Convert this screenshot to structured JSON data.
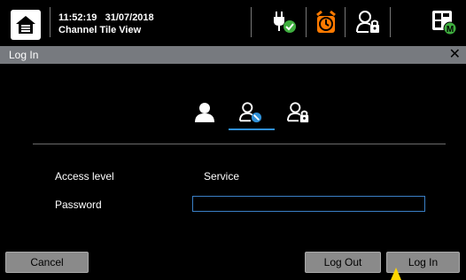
{
  "header": {
    "time": "11:52:19",
    "date": "31/07/2018",
    "view_name": "Channel Tile View",
    "icons": [
      "home-icon",
      "power-plug-check-icon",
      "alarm-clock-icon",
      "user-lock-icon",
      "tile-grid-m-icon"
    ],
    "accent_orange": "#ff7a00",
    "accent_green": "#3fae3f"
  },
  "dialog": {
    "title": "Log In",
    "close_glyph": "✕",
    "tabs": [
      "user-icon",
      "user-service-icon",
      "user-admin-icon"
    ],
    "selected_tab_color": "#2f8fd6",
    "access_level_label": "Access level",
    "access_level_value": "Service",
    "password_label": "Password",
    "password_value": "",
    "buttons": {
      "cancel": "Cancel",
      "log_out": "Log Out",
      "log_in": "Log In"
    }
  }
}
